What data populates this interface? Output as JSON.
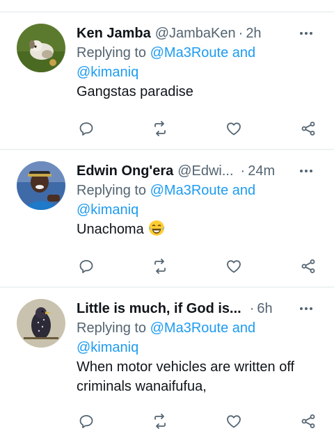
{
  "tweets": [
    {
      "name": "Ken Jamba",
      "handle": "@JambaKen",
      "dot": "·",
      "time": "2h",
      "replying_prefix": "Replying to",
      "replying_mention1": "@Ma3Route",
      "replying_and": "and",
      "replying_mention2": "@kimaniq",
      "text": "Gangstas paradise"
    },
    {
      "name": "Edwin Ong'era",
      "handle": "@Edwi...",
      "dot": "·",
      "time": "24m",
      "replying_prefix": "Replying to",
      "replying_mention1": "@Ma3Route",
      "replying_and": "and",
      "replying_mention2": "@kimaniq",
      "text": "Unachoma",
      "emoji": "face-with-tears-of-joy"
    },
    {
      "name": "Little is much, if God is...",
      "handle": "",
      "dot": "·",
      "time": "6h",
      "replying_prefix": "Replying to",
      "replying_mention1": "@Ma3Route",
      "replying_and": "and",
      "replying_mention2": "@kimaniq",
      "text_line1": "When motor vehicles are written off",
      "text_line2": "criminals wanaifufua,"
    }
  ],
  "colors": {
    "link": "#1d9bf0",
    "secondary": "#536471",
    "divider": "#eff3f4"
  },
  "icons": [
    "reply-icon",
    "retweet-icon",
    "like-icon",
    "share-icon",
    "more-icon"
  ]
}
